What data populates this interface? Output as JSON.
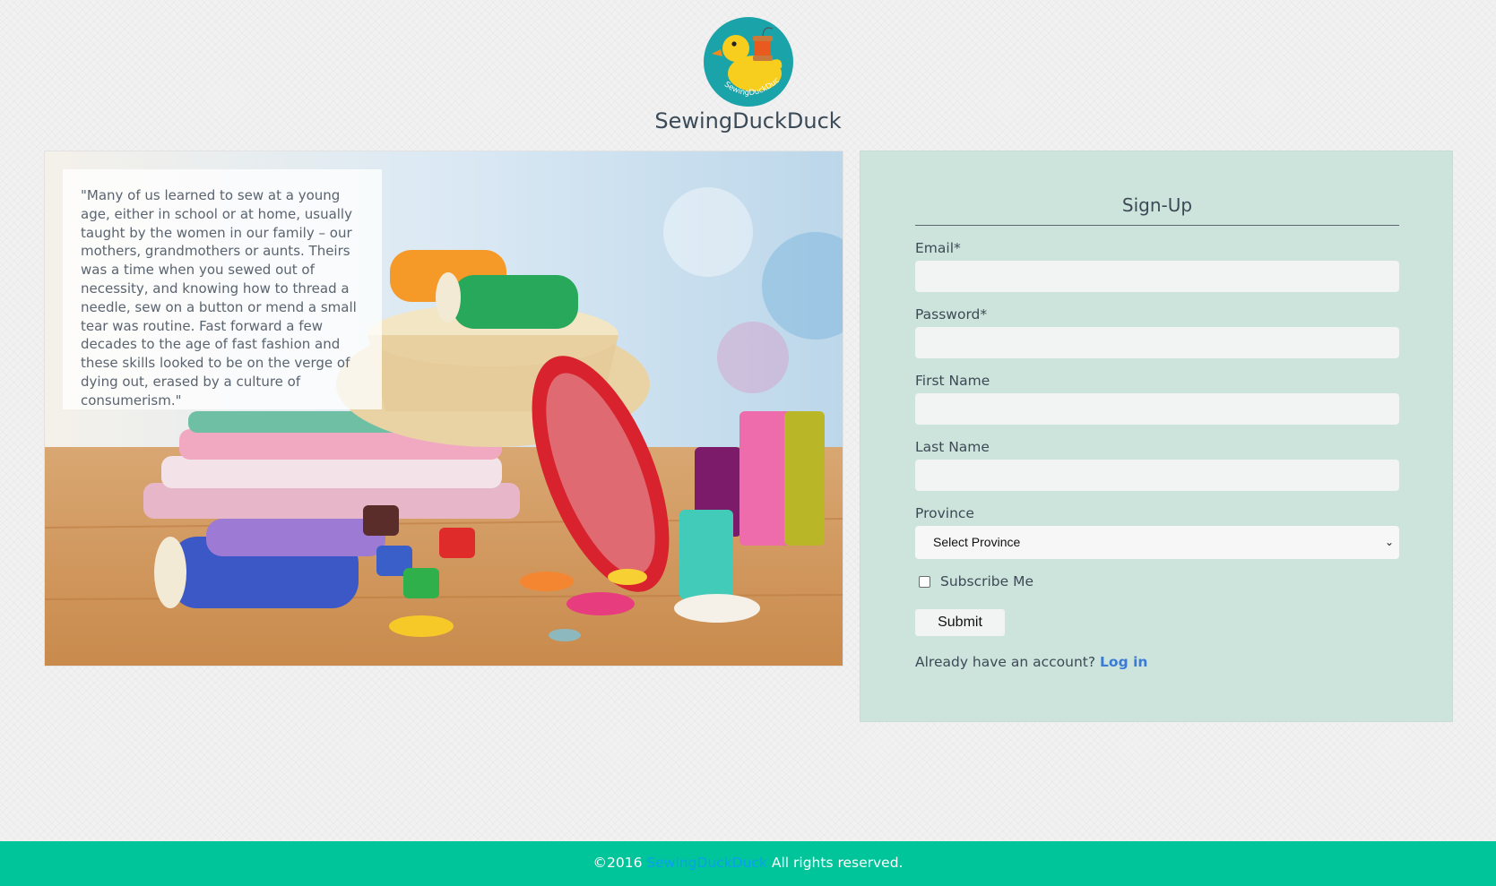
{
  "header": {
    "brand_name": "SewingDuckDuck",
    "logo_text": "SewingDuckDuck"
  },
  "hero": {
    "quote": "\"Many of us learned to sew at a young age, either in school or at home, usually taught by the women in our family – our mothers, grandmothers or aunts. Theirs was a time when you sewed out of necessity, and knowing how to thread a needle, sew on a button or mend a small tear was routine. Fast forward a few decades to the age of fast fashion and these skills looked to be on the verge of dying out, erased by a culture of consumerism.\""
  },
  "signup": {
    "title": "Sign-Up",
    "email_label": "Email*",
    "email_value": "",
    "password_label": "Password*",
    "password_value": "",
    "first_name_label": "First Name",
    "first_name_value": "",
    "last_name_label": "Last Name",
    "last_name_value": "",
    "province_label": "Province",
    "province_selected": "Select Province",
    "subscribe_label": "Subscribe Me",
    "subscribe_checked": false,
    "submit_label": "Submit",
    "login_prompt": "Already have an account?",
    "login_link": "Log in"
  },
  "footer": {
    "copyright": "©2016",
    "brand_link": "SewingDuckDuck",
    "rights": "All rights reserved."
  },
  "colors": {
    "panel_bg": "#cde4dd",
    "footer_bg": "#00c49a",
    "link_blue": "#3a7bd5",
    "logo_teal": "#1aa3a8",
    "duck_yellow": "#f7cd1e"
  }
}
